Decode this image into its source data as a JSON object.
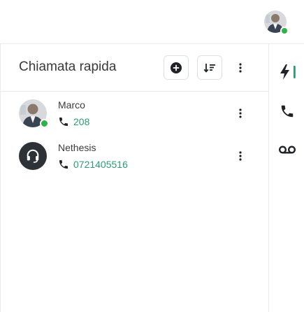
{
  "header": {
    "user_avatar": {
      "status": "online",
      "status_color": "#2fb344"
    }
  },
  "panel": {
    "title": "Chiamata rapida",
    "actions": {
      "add_icon": "plus-circle-icon",
      "sort_icon": "sort-descending-icon",
      "more_icon": "more-vertical-icon"
    }
  },
  "contacts": [
    {
      "name": "Marco",
      "number": "208",
      "avatar": "photo",
      "status": "online"
    },
    {
      "name": "Nethesis",
      "number": "0721405516",
      "avatar": "headset-icon"
    }
  ],
  "right_strip": [
    {
      "icon": "bolt-icon",
      "active": true
    },
    {
      "icon": "phone-icon",
      "active": false
    },
    {
      "icon": "voicemail-icon",
      "active": false
    }
  ],
  "colors": {
    "accent": "#2d9a77",
    "online": "#2fb344",
    "icon": "#1f2328"
  }
}
